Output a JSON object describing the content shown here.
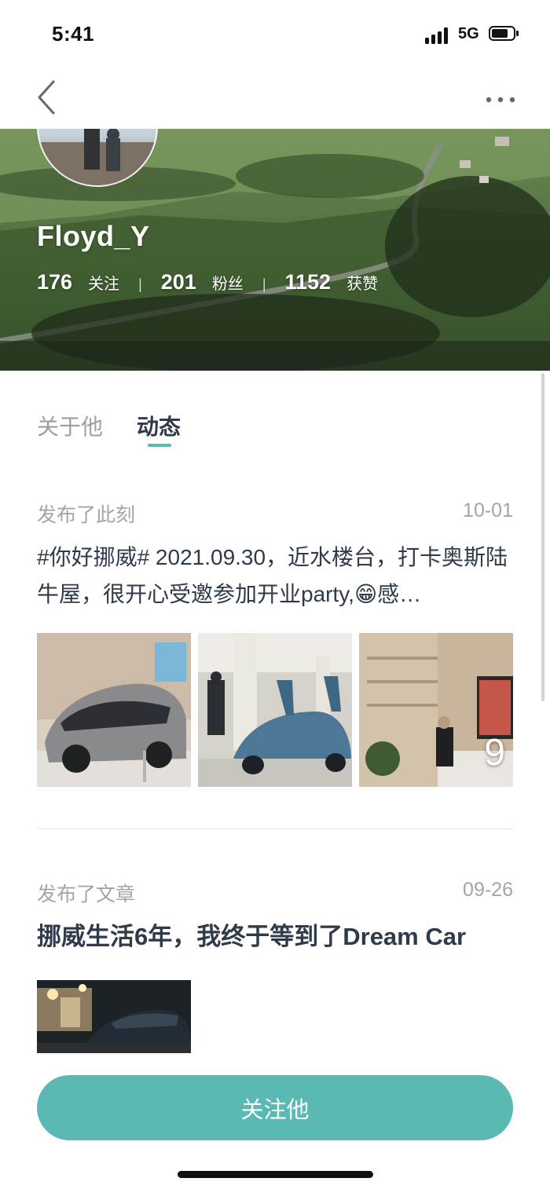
{
  "status_bar": {
    "time": "5:41",
    "network": "5G"
  },
  "nav": {
    "back_icon": "chevron-left-icon",
    "more_icon": "more-horizontal-icon"
  },
  "profile": {
    "username": "Floyd_Y",
    "stats": [
      {
        "value": "176",
        "label": "关注"
      },
      {
        "value": "201",
        "label": "粉丝"
      },
      {
        "value": "1152",
        "label": "获赞"
      }
    ]
  },
  "tabs": [
    {
      "label": "关于他",
      "active": false
    },
    {
      "label": "动态",
      "active": true
    }
  ],
  "posts": [
    {
      "type": "发布了此刻",
      "date": "10-01",
      "text": "#你好挪威# 2021.09.30，近水楼台，打卡奥斯陆牛屋，很开心受邀参加开业party,😁感…",
      "more_images_count": "9"
    },
    {
      "type": "发布了文章",
      "date": "09-26",
      "title": "挪威生活6年，我终于等到了Dream Car"
    }
  ],
  "follow_button": {
    "label": "关注他"
  },
  "colors": {
    "accent": "#5bb9b3",
    "text_primary": "#2f3a4a",
    "text_secondary": "#a0a5ad"
  }
}
